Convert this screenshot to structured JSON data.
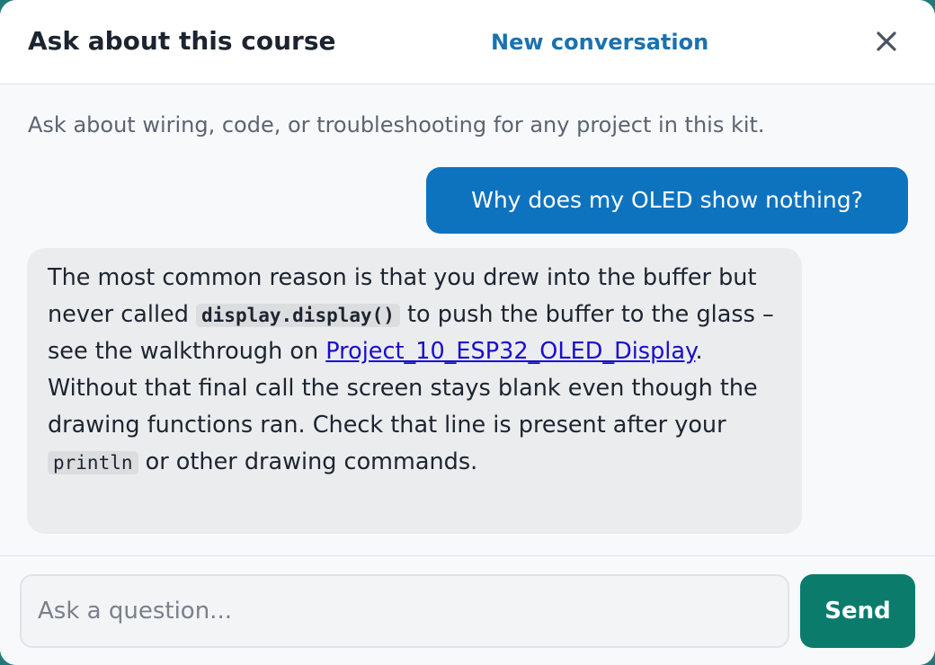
{
  "header": {
    "title": "Ask about this course",
    "new_conversation_label": "New conversation",
    "close_icon": "close-icon"
  },
  "intro_text": "Ask about wiring, code, or troubleshooting for any project in this kit.",
  "messages": {
    "user": {
      "text": "Why does my OLED show nothing?"
    },
    "assistant": {
      "part1": "The most common reason is that you drew into the buffer but never called ",
      "code1": "display.display()",
      "part2": " to push the buffer to the glass – see the walkthrough on ",
      "link_text": "Project_10_ESP32_OLED_Display",
      "part3": ". Without that final call the screen stays blank even though the drawing functions ran. Check that line is present after your ",
      "code2": "println",
      "part4": " or other drawing commands."
    }
  },
  "composer": {
    "placeholder": "Ask a question...",
    "value": "",
    "send_label": "Send"
  },
  "colors": {
    "accent_link": "#1a72b0",
    "user_bubble": "#0e73bf",
    "send_button": "#0b7c6c",
    "assistant_bubble": "#ebeced"
  }
}
